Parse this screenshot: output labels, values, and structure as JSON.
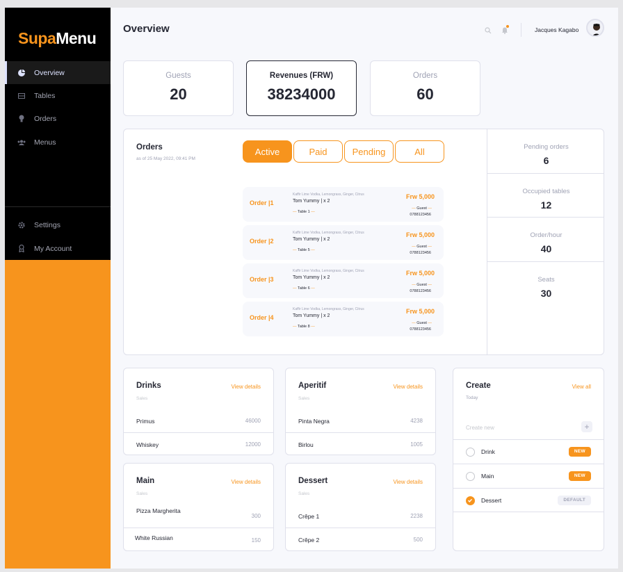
{
  "brand": {
    "part1": "Supa",
    "part2": "Menu"
  },
  "sidebar": {
    "items": [
      {
        "label": "Overview",
        "icon": "pie-chart-icon",
        "active": true
      },
      {
        "label": "Tables",
        "icon": "table-icon",
        "active": false
      },
      {
        "label": "Orders",
        "icon": "lightbulb-icon",
        "active": false
      },
      {
        "label": "Menus",
        "icon": "users-icon",
        "active": false
      },
      {
        "label": "Settings",
        "icon": "gear-icon",
        "active": false
      },
      {
        "label": "My Account",
        "icon": "badge-icon",
        "active": false
      }
    ]
  },
  "header": {
    "title": "Overview",
    "user_name": "Jacques Kagabo"
  },
  "stats": [
    {
      "label": "Guests",
      "value": "20"
    },
    {
      "label": "Revenues (FRW)",
      "value": "38234000"
    },
    {
      "label": "Orders",
      "value": "60"
    }
  ],
  "orders": {
    "title": "Orders",
    "subtitle": "as of 25 May 2022, 09:41 PM",
    "tabs": [
      "Active",
      "Paid",
      "Pending",
      "All"
    ],
    "list": [
      {
        "id": "Order |1",
        "items": "Kaffir Lime Vodka, Lemongrass, Ginger, Citrus",
        "dish": "Tom Yummy  | x 2",
        "table": "Table 1",
        "price": "Frw 5,000",
        "guest": "Guest",
        "phone": "0788123456"
      },
      {
        "id": "Order |2",
        "items": "Kaffir Lime Vodka, Lemongrass, Ginger, Citrus",
        "dish": "Tom Yummy  | x 2",
        "table": "Table 5",
        "price": "Frw 5,000",
        "guest": "Guest",
        "phone": "0788123456"
      },
      {
        "id": "Order |3",
        "items": "Kaffir Lime Vodka, Lemongrass, Ginger, Citrus",
        "dish": "Tom Yummy  | x 2",
        "table": "Table 6",
        "price": "Frw 5,000",
        "guest": "Guest",
        "phone": "0788123456"
      },
      {
        "id": "Order |4",
        "items": "Kaffir Lime Vodka, Lemongrass, Ginger, Citrus",
        "dish": "Tom Yummy  | x 2",
        "table": "Table 8",
        "price": "Frw 5,000",
        "guest": "Guest",
        "phone": "0788123456"
      }
    ],
    "side_stats": [
      {
        "label": "Pending orders",
        "value": "6"
      },
      {
        "label": "Occupied tables",
        "value": "12"
      },
      {
        "label": "Order/hour",
        "value": "40"
      },
      {
        "label": "Seats",
        "value": "30"
      }
    ]
  },
  "cards": {
    "drinks": {
      "title": "Drinks",
      "sub": "Sales",
      "link": "View details",
      "rows": [
        {
          "name": "Primus",
          "num": "46000"
        },
        {
          "name": "Whiskey",
          "num": "12000"
        }
      ]
    },
    "aperitif": {
      "title": "Aperitif",
      "sub": "Sales",
      "link": "View details",
      "rows": [
        {
          "name": "Pinta Negra",
          "num": "4238"
        },
        {
          "name": "Birlou",
          "num": "1005"
        }
      ]
    },
    "main": {
      "title": "Main",
      "sub": "Sales",
      "link": "View details",
      "rows": [
        {
          "name": "Pizza Margherita",
          "num": "300"
        },
        {
          "name": "White Russian",
          "num": "150"
        }
      ]
    },
    "dessert": {
      "title": "Dessert",
      "sub": "Sales",
      "link": "View details",
      "rows": [
        {
          "name": "Crêpe 1",
          "num": "2238"
        },
        {
          "name": "Crêpe 2",
          "num": "500"
        }
      ]
    }
  },
  "create": {
    "title": "Create",
    "sub": "Today",
    "link": "View all",
    "placeholder": "Create new",
    "items": [
      {
        "name": "Drink",
        "badge": "NEW",
        "checked": false
      },
      {
        "name": "Main",
        "badge": "NEW",
        "checked": false
      },
      {
        "name": "Dessert",
        "badge": "DEFAULT",
        "checked": true
      }
    ]
  },
  "colors": {
    "accent": "#f7941d",
    "sidebar": "#000000",
    "text": "#252733",
    "muted": "#9fa2b4"
  }
}
